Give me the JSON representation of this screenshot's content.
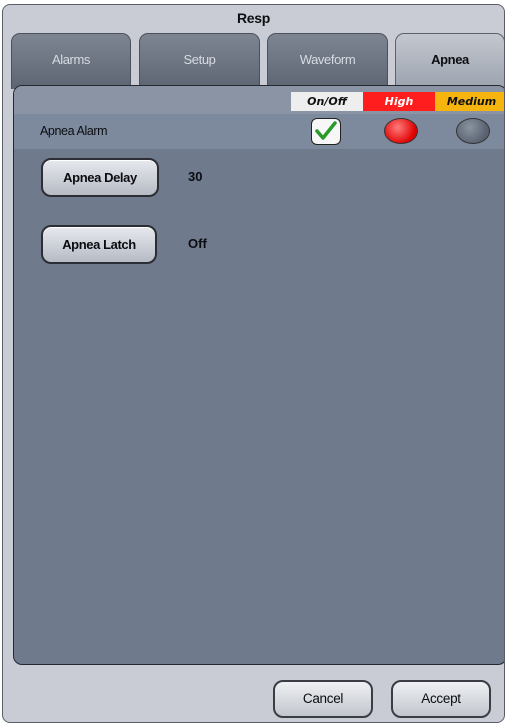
{
  "window": {
    "title": "Resp"
  },
  "tabs": [
    {
      "label": "Alarms",
      "active": false
    },
    {
      "label": "Setup",
      "active": false
    },
    {
      "label": "Waveform",
      "active": false
    },
    {
      "label": "Apnea",
      "active": true
    }
  ],
  "alarm_table": {
    "headers": {
      "on_off": "On/Off",
      "high": "High",
      "medium": "Medium"
    },
    "header_colors": {
      "on_off": "#eeeeee",
      "high": "#ff1d1d",
      "medium": "#f6b40e"
    },
    "row": {
      "label": "Apnea Alarm",
      "on_off": {
        "checked": true,
        "icon": "checkmark-icon"
      },
      "high": {
        "selected": true,
        "color": "#e00000"
      },
      "medium": {
        "selected": false,
        "color": "#5a6271"
      }
    }
  },
  "settings": [
    {
      "button_label": "Apnea Delay",
      "value": "30"
    },
    {
      "button_label": "Apnea Latch",
      "value": "Off"
    }
  ],
  "footer": {
    "cancel_label": "Cancel",
    "accept_label": "Accept"
  }
}
